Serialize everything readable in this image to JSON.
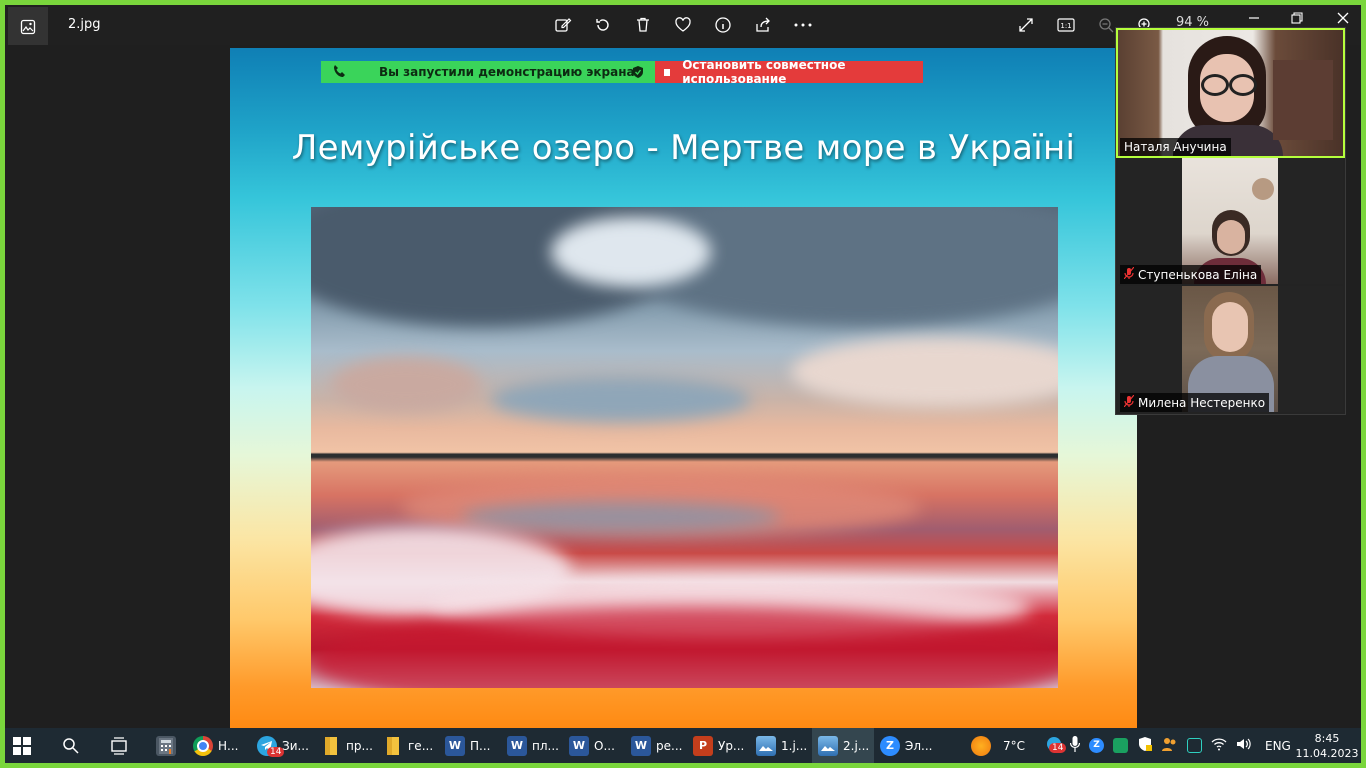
{
  "window": {
    "filename": "2.jpg",
    "zoom": "94 %"
  },
  "share_bar": {
    "sharing_text": "Вы запустили демонстрацию экрана",
    "stop_text": "Остановить совместное использование"
  },
  "slide": {
    "title": "Лемурійське озеро - Мертве море в Україні"
  },
  "participants": [
    {
      "name": "Наталя Анучина",
      "muted": false
    },
    {
      "name": "Ступенькова Еліна",
      "muted": true
    },
    {
      "name": "Милена Нестеренко",
      "muted": true
    }
  ],
  "taskbar": {
    "items": [
      {
        "label": "Н...",
        "icon": "chrome-icon"
      },
      {
        "label": "Зи...",
        "icon": "telegram-icon",
        "badge": "14"
      },
      {
        "label": "пр...",
        "icon": "folder-icon"
      },
      {
        "label": "ге...",
        "icon": "folder-icon"
      },
      {
        "label": "П...",
        "icon": "word-icon"
      },
      {
        "label": "пл...",
        "icon": "word-icon"
      },
      {
        "label": "О...",
        "icon": "word-icon"
      },
      {
        "label": "ре...",
        "icon": "word-icon"
      },
      {
        "label": "Ур...",
        "icon": "powerpoint-icon"
      },
      {
        "label": "1.j...",
        "icon": "photos-icon"
      },
      {
        "label": "2.j...",
        "icon": "photos-icon"
      },
      {
        "label": "Эл...",
        "icon": "zoom-icon"
      }
    ],
    "weather": "7°C",
    "tray_badge": "14",
    "language": "ENG",
    "time": "8:45",
    "date": "11.04.2023"
  },
  "colors": {
    "frame": "#7ad63c",
    "share_green": "#3ad45a",
    "share_red": "#e43b3b",
    "active_speaker": "#b5ff3c"
  }
}
